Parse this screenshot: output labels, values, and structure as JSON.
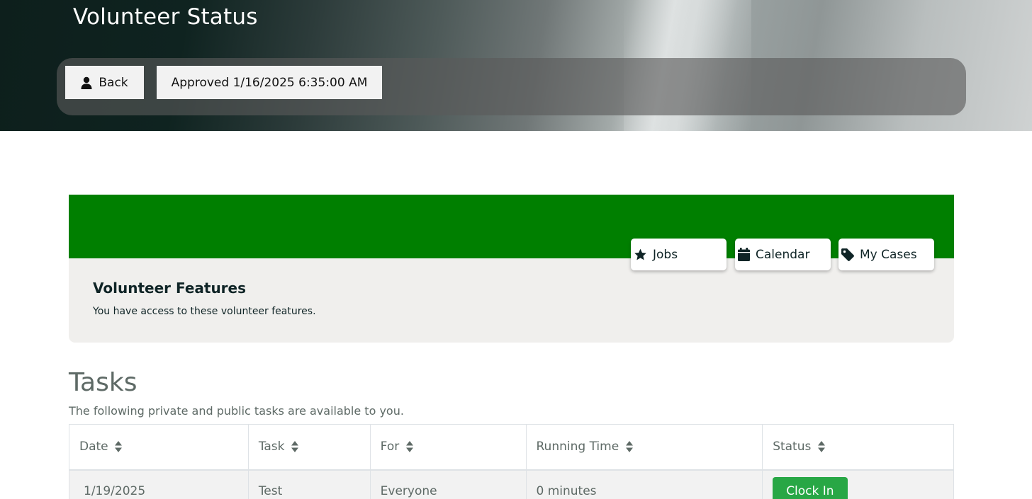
{
  "header": {
    "title": "Volunteer Status",
    "back_label": "Back",
    "status_label": "Approved 1/16/2025 6:35:00 AM"
  },
  "features": {
    "title": "Volunteer Features",
    "description": "You have access to these volunteer features.",
    "banner_color": "#007f00",
    "buttons": [
      {
        "label": "Jobs",
        "icon": "star-icon"
      },
      {
        "label": "Calendar",
        "icon": "calendar-icon"
      },
      {
        "label": "My Cases",
        "icon": "tag-icon"
      }
    ]
  },
  "tasks": {
    "title": "Tasks",
    "description": "The following private and public tasks are available to you.",
    "columns": [
      "Date",
      "Task",
      "For",
      "Running Time",
      "Status"
    ],
    "rows": [
      {
        "date": "1/19/2025",
        "task": "Test",
        "for": "Everyone",
        "running_time": "0 minutes",
        "status_button": "Clock In"
      }
    ]
  },
  "colors": {
    "accent_green": "#007f00",
    "clock_in_button": "#28a745"
  }
}
